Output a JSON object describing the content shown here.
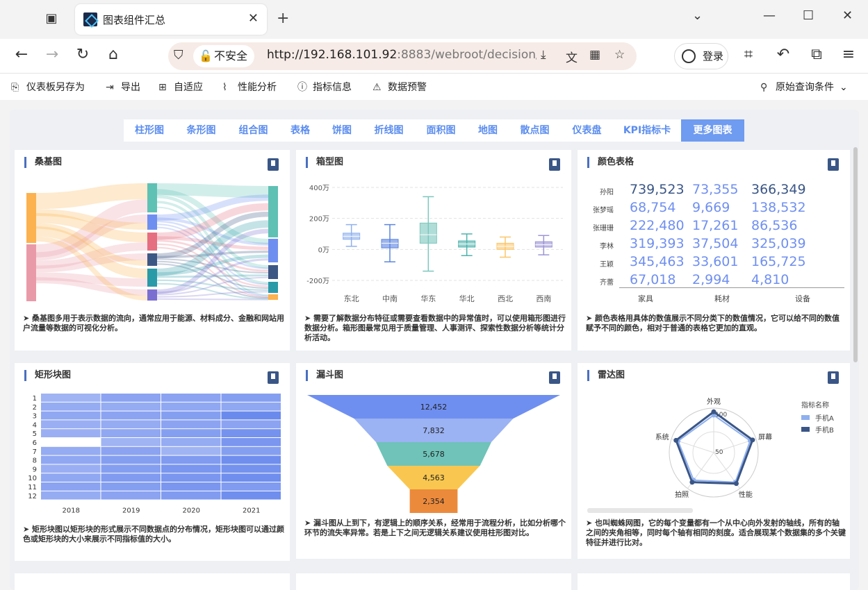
{
  "browser": {
    "tab_title": "图表组件汇总",
    "insecure_label": "不安全",
    "url_host": "http://192.168.101.92",
    "url_rest": ":8883/webroot/decision/v",
    "login_label": "登录"
  },
  "toolbar": {
    "save_as": "仪表板另存为",
    "export": "导出",
    "adaptive": "自适应",
    "performance": "性能分析",
    "indicator": "指标信息",
    "alert": "数据预警",
    "query": "原始查询条件"
  },
  "chart_tabs": [
    "柱形图",
    "条形图",
    "组合图",
    "表格",
    "饼图",
    "折线图",
    "面积图",
    "地图",
    "散点图",
    "仪表盘",
    "KPI指标卡",
    "更多图表"
  ],
  "cards": {
    "sankey": {
      "title": "桑基图",
      "desc": "➤ 桑基图多用于表示数据的流向，通常应用于能源、材料成分、金融和网站用户流量等数据的可视化分析。"
    },
    "boxplot": {
      "title": "箱型图",
      "desc": "➤ 需要了解数据分布特征或需要查看数据中的异常值时，可以使用箱形图进行数据分析。箱形图最常见用于质量管理、人事测评、探索性数据分析等统计分析活动。"
    },
    "colortable": {
      "title": "颜色表格",
      "desc": "➤ 颜色表格用具体的数值展示不同分类下的数值情况，它可以给不同的数值赋予不同的颜色，相对于普通的表格它更加的直观。",
      "columns": [
        "家具",
        "耗材",
        "设备"
      ],
      "rows": [
        {
          "name": "孙阳",
          "values": [
            "739,523",
            "73,355",
            "366,349"
          ]
        },
        {
          "name": "张梦瑶",
          "values": [
            "68,754",
            "9,669",
            "138,532"
          ]
        },
        {
          "name": "张珊珊",
          "values": [
            "222,480",
            "17,261",
            "86,536"
          ]
        },
        {
          "name": "李林",
          "values": [
            "319,393",
            "37,504",
            "325,039"
          ]
        },
        {
          "name": "王颖",
          "values": [
            "345,463",
            "33,601",
            "165,725"
          ]
        },
        {
          "name": "齐蕾",
          "values": [
            "67,018",
            "2,994",
            "4,810"
          ]
        }
      ]
    },
    "heatmap": {
      "title": "矩形块图",
      "desc": "➤ 矩形块图以矩形块的形式展示不同数据点的分布情况，矩形块图可以通过颜色或矩形块的大小来展示不同指标值的大小。"
    },
    "funnel": {
      "title": "漏斗图",
      "desc": "➤ 漏斗图从上到下，有逻辑上的顺序关系，经常用于流程分析，比如分析哪个环节的流失率异常。若是上下之间无逻辑关系建议使用柱形图对比。"
    },
    "radar": {
      "title": "雷达图",
      "desc": "➤ 也叫蜘蛛网图，它的每个变量都有一个从中心向外发射的轴线，所有的轴之间的夹角相等，同时每个轴有相同的刻度。适合展现某个数据集的多个关键特征并进行比对。"
    }
  },
  "chart_data": [
    {
      "type": "sankey",
      "title": "桑基图"
    },
    {
      "type": "box",
      "title": "箱型图",
      "categories": [
        "东北",
        "中南",
        "华东",
        "华北",
        "西北",
        "西南"
      ],
      "ytick_labels": [
        "400万",
        "200万",
        "0万",
        "-200万"
      ],
      "ylim": [
        -200,
        400
      ],
      "boxes": [
        {
          "min": 20,
          "q1": 65,
          "median": 85,
          "q3": 105,
          "max": 160,
          "color": "#8fb0ef"
        },
        {
          "min": -80,
          "q1": 10,
          "median": 40,
          "q3": 65,
          "max": 160,
          "color": "#5b84e0"
        },
        {
          "min": -140,
          "q1": 40,
          "median": 95,
          "q3": 170,
          "max": 340,
          "color": "#7cc7bd"
        },
        {
          "min": -40,
          "q1": 15,
          "median": 35,
          "q3": 55,
          "max": 100,
          "color": "#4fb3ad"
        },
        {
          "min": -50,
          "q1": 0,
          "median": 20,
          "q3": 40,
          "max": 80,
          "color": "#fbc66a"
        },
        {
          "min": -35,
          "q1": 15,
          "median": 30,
          "q3": 50,
          "max": 90,
          "color": "#9c95d6"
        }
      ]
    },
    {
      "type": "heatmap",
      "title": "矩形块图",
      "x": [
        "2018",
        "2019",
        "2020",
        "2021"
      ],
      "y": [
        "1",
        "2",
        "3",
        "4",
        "5",
        "6",
        "7",
        "8",
        "9",
        "10",
        "11",
        "12"
      ],
      "intensity": [
        [
          0.35,
          0.55,
          0.55,
          0.6
        ],
        [
          0.45,
          0.45,
          0.5,
          0.5
        ],
        [
          0.5,
          0.55,
          0.6,
          0.85
        ],
        [
          0.4,
          0.45,
          0.55,
          0.55
        ],
        [
          0.4,
          0.5,
          0.6,
          0.75
        ],
        [
          0.0,
          0.35,
          0.45,
          0.7
        ],
        [
          0.45,
          0.55,
          0.35,
          0.6
        ],
        [
          0.5,
          0.6,
          0.65,
          0.8
        ],
        [
          0.4,
          0.6,
          0.7,
          0.75
        ],
        [
          0.5,
          0.65,
          0.7,
          0.8
        ],
        [
          0.55,
          0.6,
          0.7,
          0.65
        ],
        [
          0.45,
          0.55,
          0.65,
          0.8
        ]
      ]
    },
    {
      "type": "funnel",
      "title": "漏斗图",
      "values": [
        12452,
        7832,
        5678,
        4563,
        2354
      ],
      "labels": [
        "12,452",
        "7,832",
        "5,678",
        "4,563",
        "2,354"
      ],
      "colors": [
        "#6f8ff0",
        "#9bb2f3",
        "#6fc3b9",
        "#f9c74f",
        "#ec8a3c"
      ]
    },
    {
      "type": "radar",
      "title": "雷达图",
      "axes": [
        "外观",
        "屏幕",
        "性能",
        "拍照",
        "系统"
      ],
      "tick_labels": [
        "100",
        "50"
      ],
      "legend_title": "指标名称",
      "series": [
        {
          "name": "手机A",
          "values": [
            90,
            92,
            88,
            82,
            90
          ],
          "color": "#8fb0ef"
        },
        {
          "name": "手机B",
          "values": [
            98,
            98,
            92,
            88,
            95
          ],
          "color": "#3a5686"
        }
      ]
    }
  ]
}
